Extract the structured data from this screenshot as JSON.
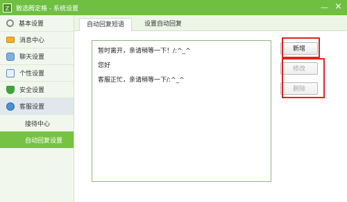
{
  "window": {
    "title": "散选腾定格 - 系统设置",
    "app_icon": "app-logo-icon",
    "minimize_glyph": "—",
    "close_glyph": "×"
  },
  "sidebar": {
    "items": [
      {
        "label": "基本设置",
        "icon": "gear-icon"
      },
      {
        "label": "消息中心",
        "icon": "mail-icon"
      },
      {
        "label": "聊天设置",
        "icon": "chat-icon"
      },
      {
        "label": "个性设置",
        "icon": "personalize-icon"
      },
      {
        "label": "安全设置",
        "icon": "shield-icon"
      },
      {
        "label": "客服设置",
        "icon": "globe-icon"
      }
    ],
    "sub_items": [
      {
        "label": "接待中心"
      },
      {
        "label": "自动回复设置"
      }
    ]
  },
  "tabs": [
    {
      "label": "自动回复短语"
    },
    {
      "label": "设置自动回复"
    }
  ],
  "phrases": [
    "暂时离开，亲请稍等一下！/:^_^",
    "您好",
    "客服正忙，亲请稍等一下/:^_^"
  ],
  "buttons": {
    "add": "新增",
    "edit": "修改",
    "delete": "删除"
  },
  "colors": {
    "titlebar": "#6fbf40",
    "active_sub_item": "#77c244",
    "annotation_red": "#e0211a"
  }
}
